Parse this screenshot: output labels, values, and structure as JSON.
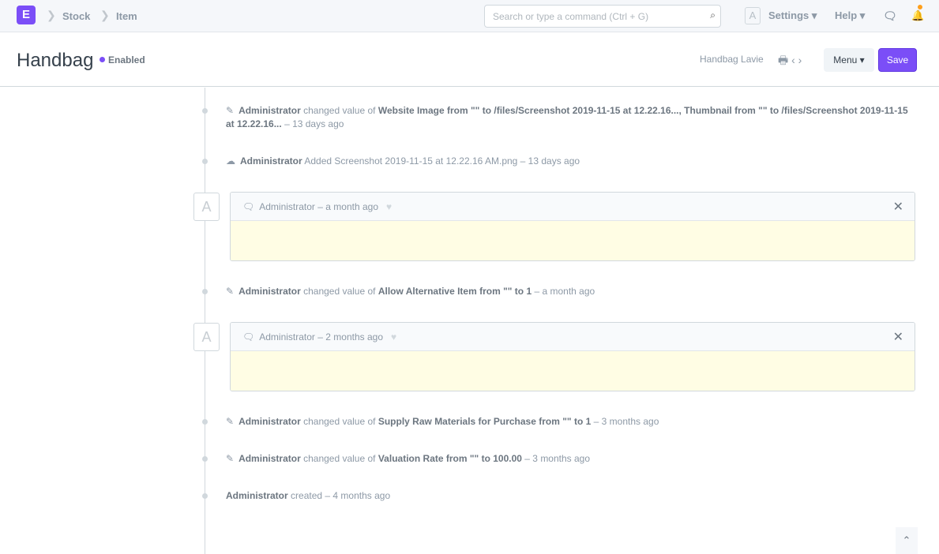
{
  "nav": {
    "logo": "E",
    "breadcrumbs": [
      "Stock",
      "Item"
    ],
    "search_placeholder": "Search or type a command (Ctrl + G)",
    "avatar": "A",
    "settings": "Settings",
    "help": "Help"
  },
  "header": {
    "title": "Handbag",
    "status": "Enabled",
    "record_name": "Handbag Lavie",
    "menu": "Menu",
    "save": "Save"
  },
  "timeline": [
    {
      "user": "Administrator",
      "action": "changed value of",
      "detail": "Website Image from \"\" to /files/Screenshot 2019-11-15 at 12.22.16..., Thumbnail from \"\" to /files/Screenshot 2019-11-15 at 12.22.16...",
      "time": "– 13 days ago"
    },
    {
      "user": "Administrator",
      "action": "Added Screenshot 2019-11-15 at 12.22.16 AM.png – 13 days ago"
    },
    {
      "user": "Administrator",
      "time": "– a month ago",
      "avatar": "A"
    },
    {
      "user": "Administrator",
      "action": "changed value of",
      "detail": "Allow Alternative Item from \"\" to 1",
      "time": "– a month ago"
    },
    {
      "user": "Administrator",
      "time": "– 2 months ago",
      "avatar": "A"
    },
    {
      "user": "Administrator",
      "action": "changed value of",
      "detail": "Supply Raw Materials for Purchase from \"\" to 1",
      "time": "– 3 months ago"
    },
    {
      "user": "Administrator",
      "action": "changed value of",
      "detail": "Valuation Rate from \"\" to 100.00",
      "time": "– 3 months ago"
    },
    {
      "user": "Administrator",
      "action": "created",
      "time": "– 4 months ago"
    }
  ]
}
